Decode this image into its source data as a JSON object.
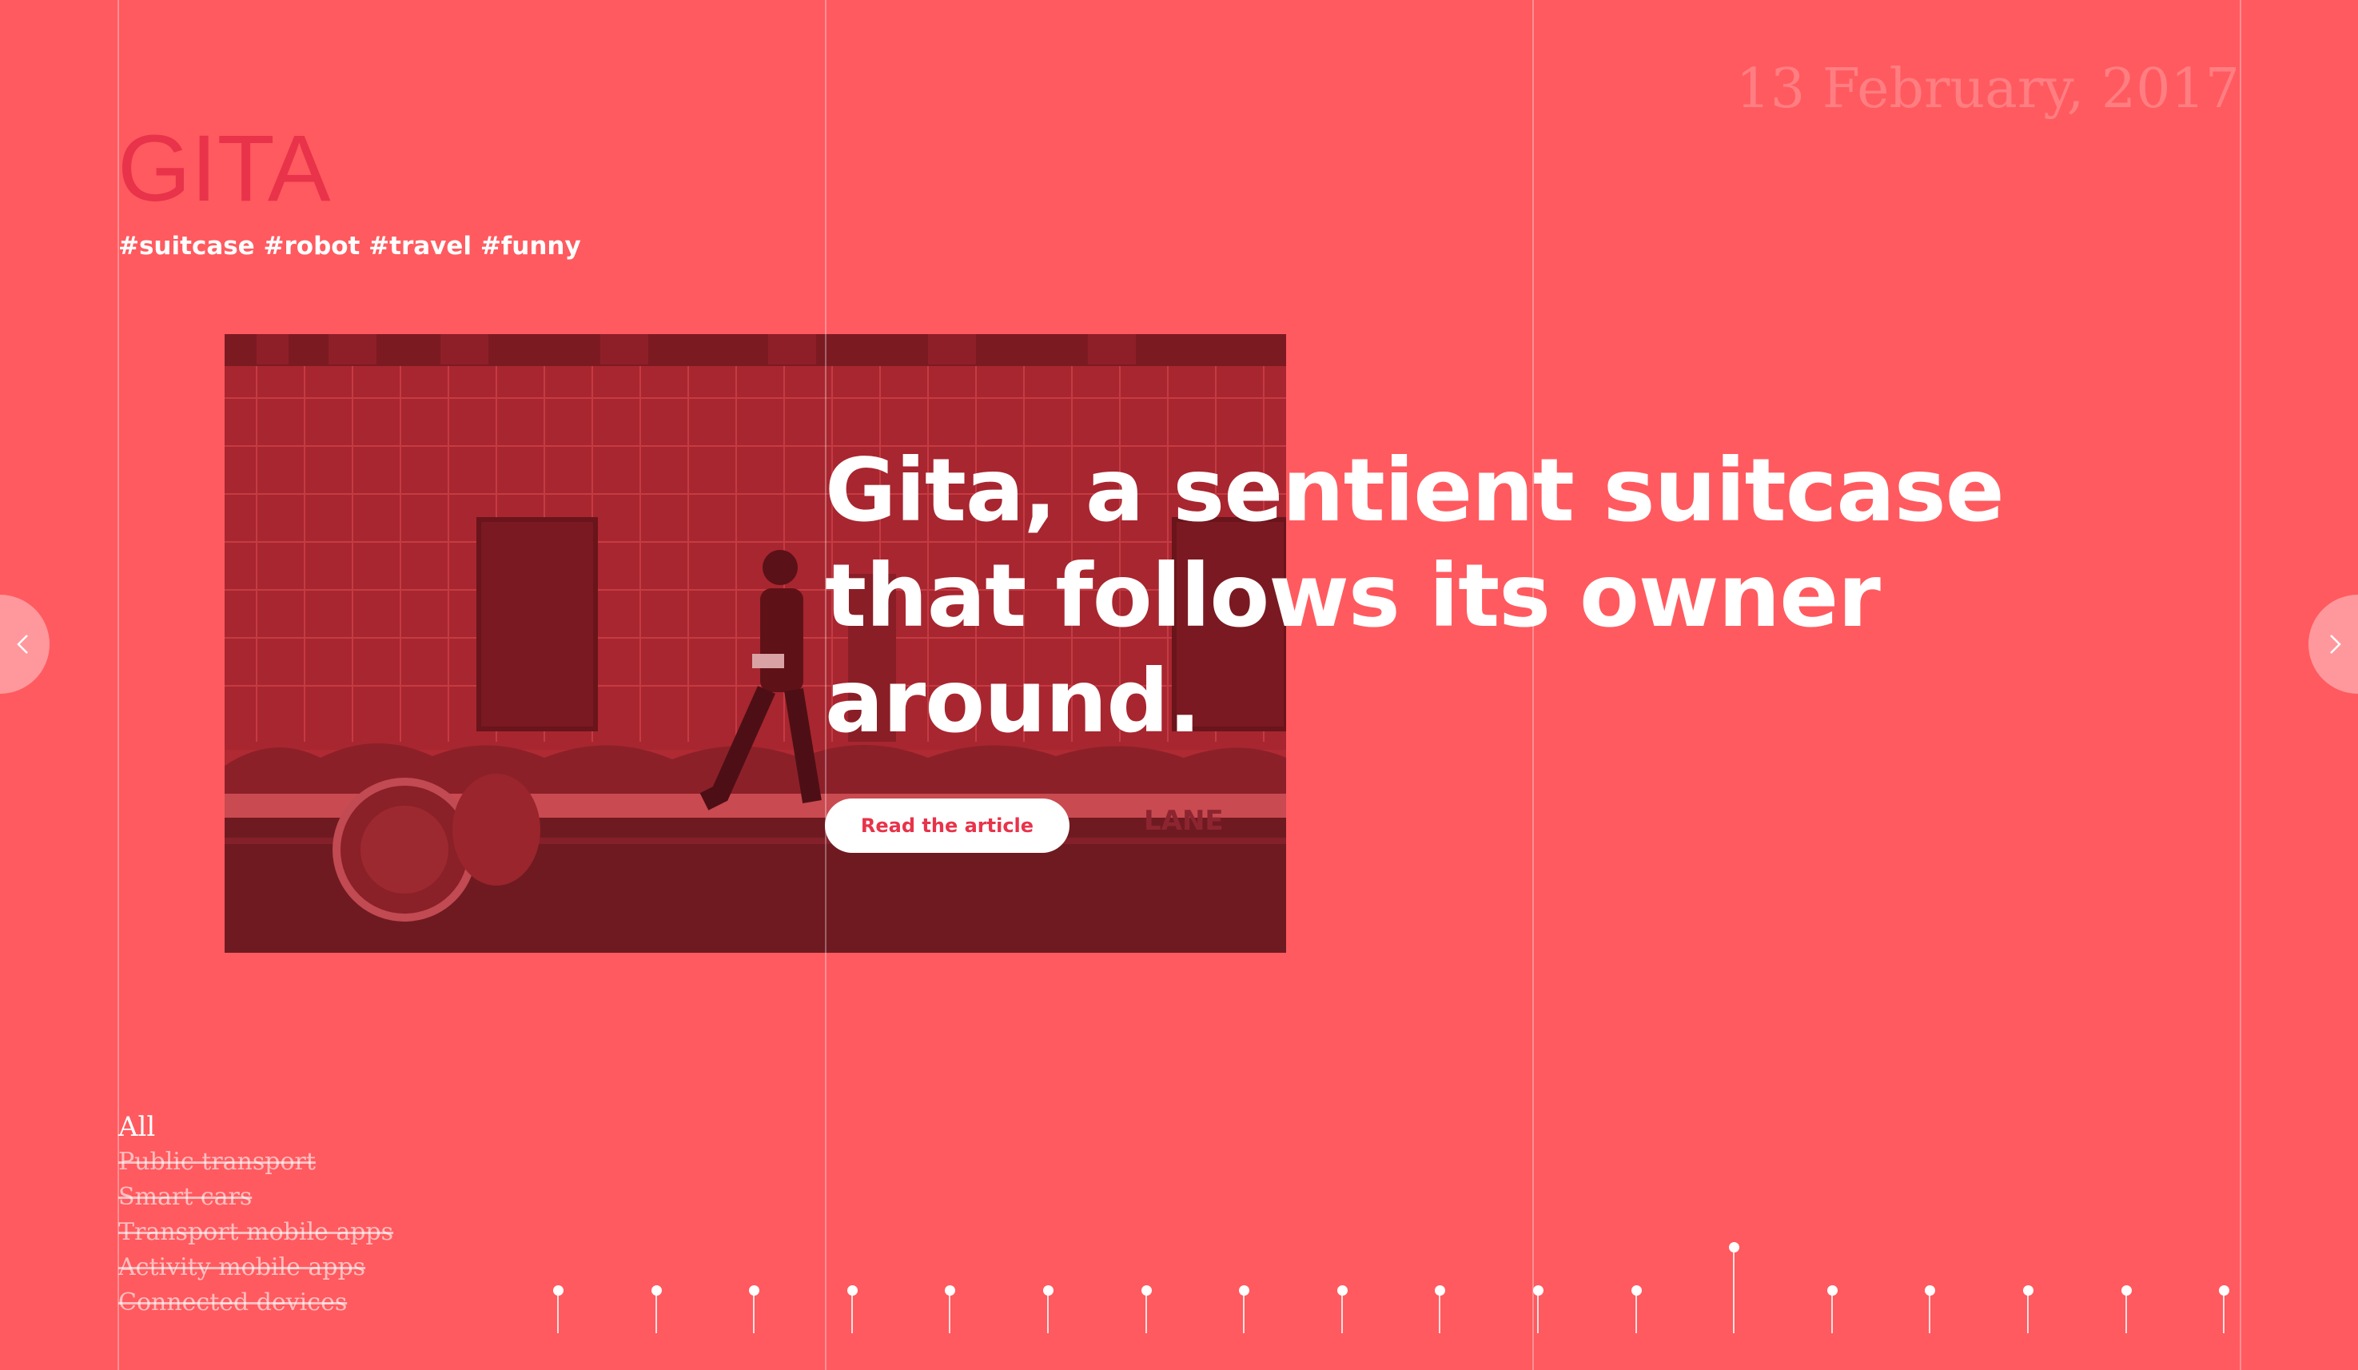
{
  "article": {
    "date": "13 February, 2017",
    "title": "GITA",
    "tags": "#suitcase #robot #travel #funny",
    "headline": "Gita, a sentient suitcase that follows its owner around.",
    "cta_label": "Read the article"
  },
  "filters": {
    "items": [
      "All",
      "Public transport",
      "Smart cars",
      "Transport mobile apps",
      "Activity mobile apps",
      "Connected devices"
    ]
  },
  "timeline": {
    "count": 18,
    "active_index": 12
  },
  "colors": {
    "background": "#ff5a5f",
    "title": "#e8334a",
    "accent": "#e8334a",
    "text": "#ffffff"
  },
  "icons": {
    "prev": "chevron-left-icon",
    "next": "chevron-right-icon"
  }
}
